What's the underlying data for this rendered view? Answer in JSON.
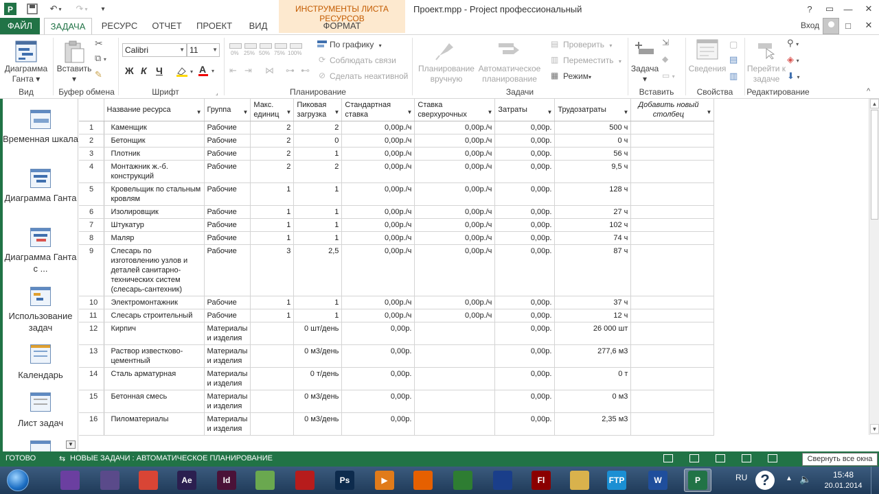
{
  "app": {
    "window_title": "Проект.mpp - Project профессиональный",
    "contextual_tab_group": "ИНСТРУМЕНТЫ ЛИСТА РЕСУРСОВ",
    "sign_in": "Вход",
    "controls": {
      "help": "?",
      "restore": "▭",
      "minimize": "—",
      "maximize": "□",
      "close": "✕"
    }
  },
  "ribbon": {
    "tabs": [
      {
        "label": "ФАЙЛ",
        "active": false
      },
      {
        "label": "ЗАДАЧА",
        "active": true
      },
      {
        "label": "РЕСУРС",
        "active": false
      },
      {
        "label": "ОТЧЕТ",
        "active": false
      },
      {
        "label": "ПРОЕКТ",
        "active": false
      },
      {
        "label": "ВИД",
        "active": false
      },
      {
        "label": "ФОРМАТ",
        "active": false
      }
    ],
    "groups": {
      "view": {
        "label": "Вид",
        "gantt": "Диаграмма Ганта"
      },
      "clipboard": {
        "label": "Буфер обмена",
        "paste": "Вставить"
      },
      "font": {
        "label": "Шрифт",
        "font_name": "Calibri",
        "font_size": "11",
        "bold": "Ж",
        "italic": "К",
        "underline": "Ч"
      },
      "schedule": {
        "label": "Планирование",
        "on_schedule": "По графику",
        "respect_links": "Соблюдать связи",
        "inactivate": "Сделать неактивной",
        "pcts": [
          "0%",
          "25%",
          "50%",
          "75%",
          "100%"
        ]
      },
      "tasks": {
        "label": "Задачи",
        "manual": "Планирование вручную",
        "auto": "Автоматическое планирование",
        "inspect": "Проверить",
        "move": "Переместить",
        "mode": "Режим"
      },
      "insert": {
        "label": "Вставить",
        "task": "Задача"
      },
      "properties": {
        "label": "Свойства",
        "info": "Сведения"
      },
      "editing": {
        "label": "Редактирование",
        "goto": "Перейти к задаче"
      }
    }
  },
  "viewbar": {
    "items": [
      {
        "label": "Временная шкала"
      },
      {
        "label": "Диаграмма Ганта"
      },
      {
        "label": "Диаграмма Ганта с ..."
      },
      {
        "label": "Использование задач"
      },
      {
        "label": "Календарь"
      },
      {
        "label": "Лист задач"
      }
    ]
  },
  "sheet": {
    "columns": [
      "Название ресурса",
      "Группа",
      "Макс. единиц",
      "Пиковая загрузка",
      "Стандартная ставка",
      "Ставка сверхурочных",
      "Затраты",
      "Трудозатраты",
      "Добавить новый столбец"
    ],
    "rows": [
      {
        "id": "1",
        "name": "Каменщик",
        "group": "Рабочие",
        "max": "2",
        "peak": "2",
        "std": "0,00р./ч",
        "ovt": "0,00р./ч",
        "cost": "0,00р.",
        "work": "500 ч"
      },
      {
        "id": "2",
        "name": "Бетонщик",
        "group": "Рабочие",
        "max": "2",
        "peak": "0",
        "std": "0,00р./ч",
        "ovt": "0,00р./ч",
        "cost": "0,00р.",
        "work": "0 ч"
      },
      {
        "id": "3",
        "name": "Плотник",
        "group": "Рабочие",
        "max": "2",
        "peak": "1",
        "std": "0,00р./ч",
        "ovt": "0,00р./ч",
        "cost": "0,00р.",
        "work": "56 ч"
      },
      {
        "id": "4",
        "name": "Монтажник ж.-б. конструкций",
        "group": "Рабочие",
        "max": "2",
        "peak": "2",
        "std": "0,00р./ч",
        "ovt": "0,00р./ч",
        "cost": "0,00р.",
        "work": "9,5 ч"
      },
      {
        "id": "5",
        "name": "Кровельщик по стальным кровлям",
        "group": "Рабочие",
        "max": "1",
        "peak": "1",
        "std": "0,00р./ч",
        "ovt": "0,00р./ч",
        "cost": "0,00р.",
        "work": "128 ч"
      },
      {
        "id": "6",
        "name": "Изолировщик",
        "group": "Рабочие",
        "max": "1",
        "peak": "1",
        "std": "0,00р./ч",
        "ovt": "0,00р./ч",
        "cost": "0,00р.",
        "work": "27 ч"
      },
      {
        "id": "7",
        "name": "Штукатур",
        "group": "Рабочие",
        "max": "1",
        "peak": "1",
        "std": "0,00р./ч",
        "ovt": "0,00р./ч",
        "cost": "0,00р.",
        "work": "102 ч"
      },
      {
        "id": "8",
        "name": "Маляр",
        "group": "Рабочие",
        "max": "1",
        "peak": "1",
        "std": "0,00р./ч",
        "ovt": "0,00р./ч",
        "cost": "0,00р.",
        "work": "74 ч"
      },
      {
        "id": "9",
        "name": "Слесарь по изготовлению узлов и деталей санитарно-технических систем (слесарь-сантехник)",
        "group": "Рабочие",
        "max": "3",
        "peak": "2,5",
        "std": "0,00р./ч",
        "ovt": "0,00р./ч",
        "cost": "0,00р.",
        "work": "87 ч"
      },
      {
        "id": "10",
        "name": "Электромонтажник",
        "group": "Рабочие",
        "max": "1",
        "peak": "1",
        "std": "0,00р./ч",
        "ovt": "0,00р./ч",
        "cost": "0,00р.",
        "work": "37 ч"
      },
      {
        "id": "11",
        "name": "Слесарь строительный",
        "group": "Рабочие",
        "max": "1",
        "peak": "1",
        "std": "0,00р./ч",
        "ovt": "0,00р./ч",
        "cost": "0,00р.",
        "work": "12 ч"
      },
      {
        "id": "12",
        "name": "Кирпич",
        "group": "Материалы и изделия",
        "max": "",
        "peak": "0 шт/день",
        "std": "0,00р.",
        "ovt": "",
        "cost": "0,00р.",
        "work": "26 000 шт"
      },
      {
        "id": "13",
        "name": "Раствор известково-цементный",
        "group": "Материалы и изделия",
        "max": "",
        "peak": "0 м3/день",
        "std": "0,00р.",
        "ovt": "",
        "cost": "0,00р.",
        "work": "277,6 м3"
      },
      {
        "id": "14",
        "name": "Сталь арматурная",
        "group": "Материалы и изделия",
        "max": "",
        "peak": "0 т/день",
        "std": "0,00р.",
        "ovt": "",
        "cost": "0,00р.",
        "work": "0 т"
      },
      {
        "id": "15",
        "name": "Бетонная смесь",
        "group": "Материалы и изделия",
        "max": "",
        "peak": "0 м3/день",
        "std": "0,00р.",
        "ovt": "",
        "cost": "0,00р.",
        "work": "0 м3"
      },
      {
        "id": "16",
        "name": "Пиломатериалы",
        "group": "Материалы и изделия",
        "max": "",
        "peak": "0 м3/день",
        "std": "0,00р.",
        "ovt": "",
        "cost": "0,00р.",
        "work": "2,35 м3"
      }
    ]
  },
  "statusbar": {
    "ready": "ГОТОВО",
    "new_tasks": "НОВЫЕ ЗАДАЧИ : АВТОМАТИЧЕСКОЕ ПЛАНИРОВАНИЕ",
    "tooltip": "Свернуть все окна"
  },
  "taskbar": {
    "apps": [
      {
        "icon": "prism-icon",
        "color": "#6b3fa0",
        "text": ""
      },
      {
        "icon": "photo-viewer-icon",
        "color": "#5a4a8a",
        "text": ""
      },
      {
        "icon": "chrome-icon",
        "color": "#d94535",
        "text": ""
      },
      {
        "icon": "after-effects-icon",
        "color": "#2b1f4f",
        "text": "Ae"
      },
      {
        "icon": "indesign-icon",
        "color": "#4a1238",
        "text": "Id"
      },
      {
        "icon": "corel-icon",
        "color": "#6aa84f",
        "text": ""
      },
      {
        "icon": "autocad-icon",
        "color": "#b71c1c",
        "text": ""
      },
      {
        "icon": "photoshop-icon",
        "color": "#0d2b4d",
        "text": "Ps"
      },
      {
        "icon": "media-player-icon",
        "color": "#e07b1a",
        "text": "▶"
      },
      {
        "icon": "firefox-icon",
        "color": "#e66000",
        "text": ""
      },
      {
        "icon": "stock-app-icon",
        "color": "#2e7d32",
        "text": ""
      },
      {
        "icon": "floppy-icon",
        "color": "#1a3e8a",
        "text": ""
      },
      {
        "icon": "flash-icon",
        "color": "#8b0000",
        "text": "Fl"
      },
      {
        "icon": "explorer-icon",
        "color": "#d9b24c",
        "text": ""
      },
      {
        "icon": "cuteftp-icon",
        "color": "#1b8fd3",
        "text": "FTP"
      },
      {
        "icon": "word-icon",
        "color": "#1f4e9c",
        "text": "W"
      },
      {
        "icon": "project-icon",
        "color": "#217346",
        "text": "P"
      }
    ],
    "lang": "RU",
    "time": "15:48",
    "date": "20.01.2014"
  }
}
